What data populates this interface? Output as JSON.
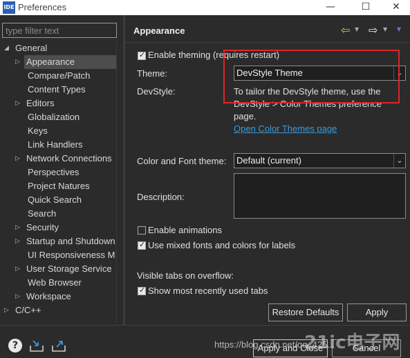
{
  "window": {
    "app_icon": "IDE",
    "title": "Preferences",
    "minimize": "—",
    "maximize": "☐",
    "close": "✕"
  },
  "filter": {
    "placeholder": "type filter text"
  },
  "tree": [
    {
      "label": "General",
      "arrow": "◢",
      "level": 0
    },
    {
      "label": "Appearance",
      "arrow": "▷",
      "level": 1,
      "selected": true
    },
    {
      "label": "Compare/Patch",
      "arrow": "",
      "level": 1
    },
    {
      "label": "Content Types",
      "arrow": "",
      "level": 1
    },
    {
      "label": "Editors",
      "arrow": "▷",
      "level": 1
    },
    {
      "label": "Globalization",
      "arrow": "",
      "level": 1
    },
    {
      "label": "Keys",
      "arrow": "",
      "level": 1
    },
    {
      "label": "Link Handlers",
      "arrow": "",
      "level": 1
    },
    {
      "label": "Network Connections",
      "arrow": "▷",
      "level": 1
    },
    {
      "label": "Perspectives",
      "arrow": "",
      "level": 1
    },
    {
      "label": "Project Natures",
      "arrow": "",
      "level": 1
    },
    {
      "label": "Quick Search",
      "arrow": "",
      "level": 1
    },
    {
      "label": "Search",
      "arrow": "",
      "level": 1
    },
    {
      "label": "Security",
      "arrow": "▷",
      "level": 1
    },
    {
      "label": "Startup and Shutdown",
      "arrow": "▷",
      "level": 1
    },
    {
      "label": "UI Responsiveness M",
      "arrow": "",
      "level": 1
    },
    {
      "label": "User Storage Service",
      "arrow": "▷",
      "level": 1
    },
    {
      "label": "Web Browser",
      "arrow": "",
      "level": 1
    },
    {
      "label": "Workspace",
      "arrow": "▷",
      "level": 1
    },
    {
      "label": "C/C++",
      "arrow": "▷",
      "level": 0
    }
  ],
  "page": {
    "title": "Appearance",
    "nav": {
      "back": "⇦",
      "back_dd": "▼",
      "forward": "⇨",
      "forward_dd": "▼",
      "menu": "▼"
    },
    "enable_theming": {
      "label": "Enable theming (requires restart)",
      "checked": true
    },
    "theme": {
      "label": "Theme:",
      "value": "DevStyle Theme"
    },
    "devstyle": {
      "label": "DevStyle:",
      "line1": "To tailor the DevStyle theme, use the",
      "line2": "DevStyle > Color Themes preference",
      "line3": "page.",
      "link": "Open Color Themes page"
    },
    "color_font_theme": {
      "label": "Color and Font theme:",
      "value": "Default (current)"
    },
    "description": {
      "label": "Description:"
    },
    "enable_animations": {
      "label": "Enable animations",
      "checked": false
    },
    "mixed_fonts": {
      "label": "Use mixed fonts and colors for labels",
      "checked": true
    },
    "visible_tabs": {
      "label": "Visible tabs on overflow:"
    },
    "show_recent_tabs": {
      "label": "Show most recently used tabs",
      "checked": true
    },
    "restore_defaults": "Restore Defaults",
    "apply": "Apply"
  },
  "bottom": {
    "help": "?",
    "apply_and_close": "Apply and Close",
    "cancel": "Cancel",
    "watermark": "https://blog.csdn.net/qq_425...",
    "watermark_logo": "21ic电子网"
  },
  "colors": {
    "accent_link": "#3a9bdc",
    "highlight_box": "#e0242a",
    "background": "#2b2b2b"
  }
}
